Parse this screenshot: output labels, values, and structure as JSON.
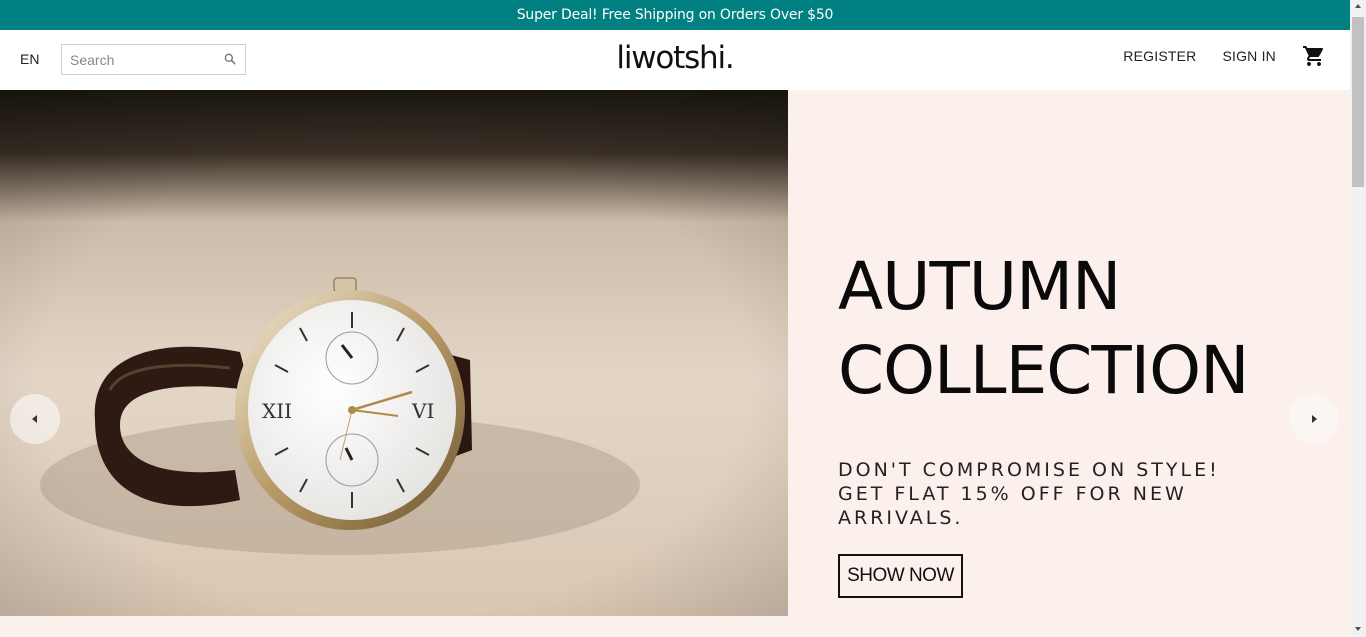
{
  "announcement": {
    "text": "Super Deal! Free Shipping on Orders Over $50"
  },
  "header": {
    "language": "EN",
    "search": {
      "placeholder": "Search",
      "value": ""
    },
    "logo": "liwotshi.",
    "links": {
      "register": "REGISTER",
      "sign_in": "SIGN IN"
    }
  },
  "hero": {
    "title_line1": "AUTUMN",
    "title_line2": "COLLECTION",
    "description": "DON'T COMPROMISE ON STYLE! GET FLAT 15% OFF FOR NEW ARRIVALS.",
    "button_label": "SHOW NOW",
    "background_color": "#fbf0ec"
  },
  "theme": {
    "accent": "#008080"
  },
  "icons": {
    "search": "search-icon",
    "cart": "shopping-cart-icon",
    "prev": "arrow-left-icon",
    "next": "arrow-right-icon"
  }
}
